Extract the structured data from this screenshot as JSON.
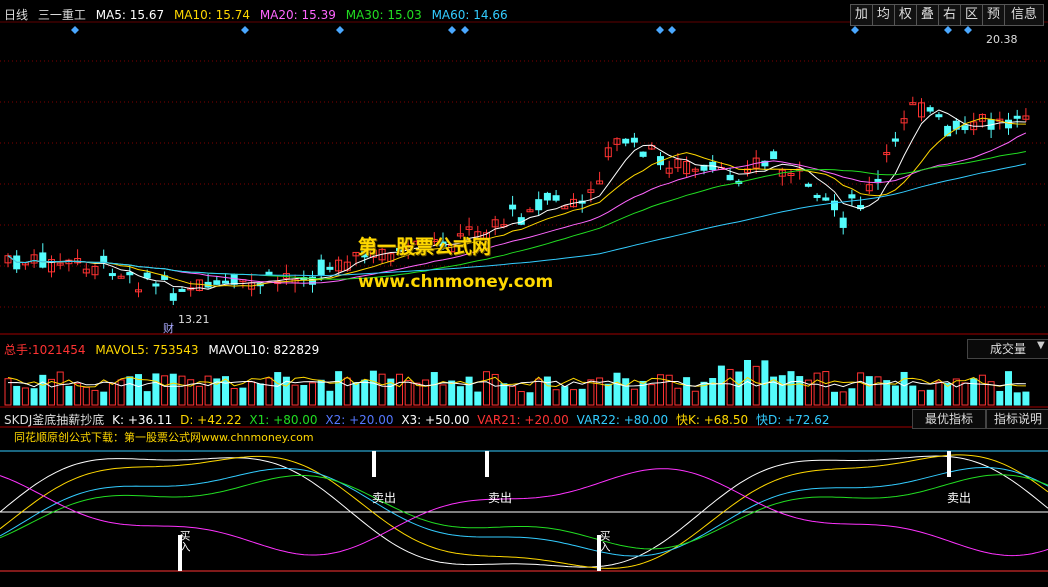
{
  "header": {
    "period": "日线",
    "stock": "三一重工",
    "ma": [
      {
        "label": "MA5: 15.67",
        "color": "#ffffff"
      },
      {
        "label": "MA10: 15.74",
        "color": "#ffd800"
      },
      {
        "label": "MA20: 15.39",
        "color": "#ff66ff"
      },
      {
        "label": "MA30: 15.03",
        "color": "#22dd22"
      },
      {
        "label": "MA60: 14.66",
        "color": "#33ccff"
      }
    ]
  },
  "toolbar": [
    "加",
    "均",
    "权",
    "叠",
    "右",
    "区",
    "预",
    "信息"
  ],
  "price": {
    "high_label": "20.38",
    "low_label": "13.21",
    "cai_label": "财"
  },
  "watermark": {
    "line1": "第一股票公式网",
    "line2": "www.chnmoney.com"
  },
  "volume": {
    "total_label": "总手:",
    "total_value": "1021454",
    "mavol5": "MAVOL5: 753543",
    "mavol10": "MAVOL10: 822829",
    "button": "成交量"
  },
  "skdj": {
    "name": "SKDJ釜底抽薪抄底",
    "values": [
      {
        "label": "K: +36.11",
        "color": "#ffffff"
      },
      {
        "label": "D: +42.22",
        "color": "#ffd800"
      },
      {
        "label": "X1: +80.00",
        "color": "#22dd22"
      },
      {
        "label": "X2: +20.00",
        "color": "#5577ff"
      },
      {
        "label": "X3: +50.00",
        "color": "#ffffff"
      },
      {
        "label": "VAR21: +20.00",
        "color": "#ff3333"
      },
      {
        "label": "VAR22: +80.00",
        "color": "#33ccff"
      },
      {
        "label": "快K: +68.50",
        "color": "#ffd800"
      },
      {
        "label": "快D: +72.62",
        "color": "#33ccff"
      }
    ],
    "subtitle": "同花顺原创公式下载：第一股票公式网www.chnmoney.com",
    "btn_best": "最优指标",
    "btn_help": "指标说明",
    "signals": {
      "sell": "卖出",
      "buy": "买入"
    }
  },
  "colors": {
    "up": "#ff3232",
    "down": "#54fcfc",
    "grid": "#800000"
  }
}
